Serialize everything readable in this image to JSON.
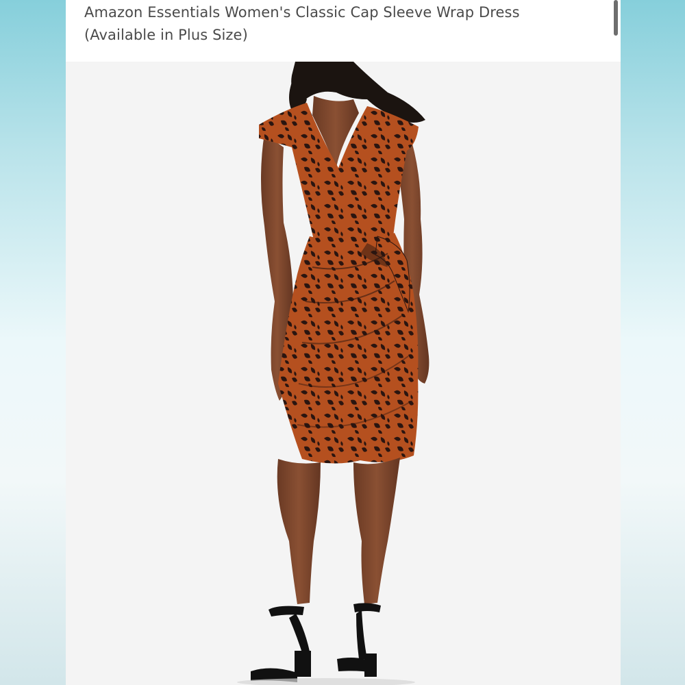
{
  "product": {
    "title": "Amazon Essentials Women's Classic Cap Sleeve Wrap Dress (Available in Plus Size)"
  },
  "image": {
    "subject": "product-photo",
    "dress_color": "#b5501f",
    "pattern_color": "#2a1510"
  },
  "colors": {
    "background_accent": "#8ed3de",
    "photo_background": "#f4f4f4",
    "title_text": "#4a4a4a"
  }
}
